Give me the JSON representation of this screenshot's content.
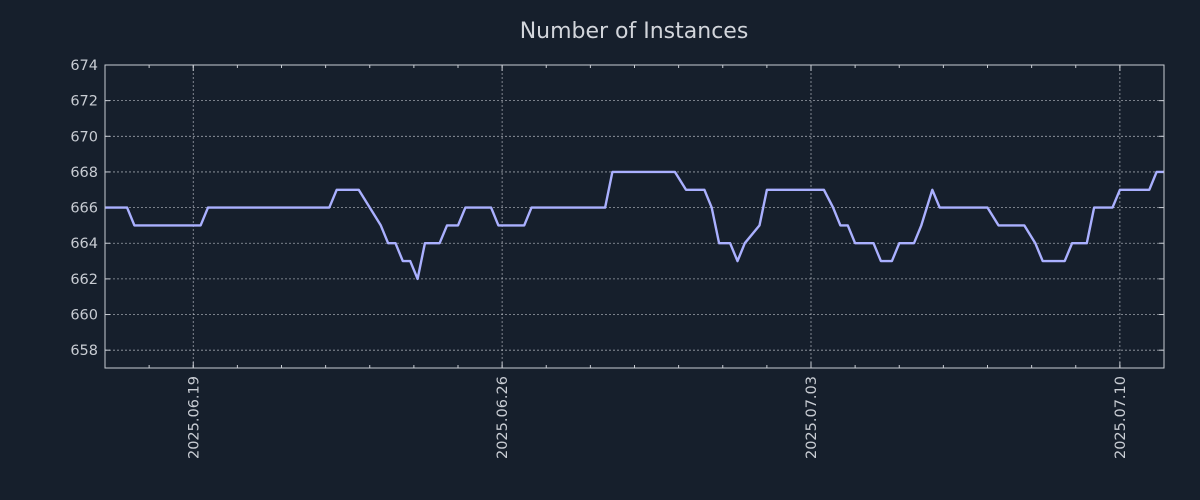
{
  "chart_data": {
    "type": "line",
    "title": "Number of Instances",
    "xlabel": "",
    "ylabel": "",
    "x_range": [
      "2025.06.17",
      "2025.07.11"
    ],
    "ylim": [
      657,
      674
    ],
    "y_ticks": [
      658,
      660,
      662,
      664,
      666,
      668,
      670,
      672,
      674
    ],
    "x_ticks": [
      "2025.06.19",
      "2025.06.26",
      "2025.07.03",
      "2025.07.10"
    ],
    "grid": true,
    "series": [
      {
        "name": "",
        "color": "#aab0ff",
        "points": [
          [
            "2025.06.17 00:00",
            666
          ],
          [
            "2025.06.17 12:00",
            666
          ],
          [
            "2025.06.17 16:00",
            665
          ],
          [
            "2025.06.18 00:00",
            665
          ],
          [
            "2025.06.18 12:00",
            665
          ],
          [
            "2025.06.18 18:00",
            665
          ],
          [
            "2025.06.19 04:00",
            665
          ],
          [
            "2025.06.19 08:00",
            666
          ],
          [
            "2025.06.20 00:00",
            666
          ],
          [
            "2025.06.21 00:00",
            666
          ],
          [
            "2025.06.22 00:00",
            666
          ],
          [
            "2025.06.22 02:00",
            666
          ],
          [
            "2025.06.22 06:00",
            667
          ],
          [
            "2025.06.22 18:00",
            667
          ],
          [
            "2025.06.23 00:00",
            666
          ],
          [
            "2025.06.23 06:00",
            665
          ],
          [
            "2025.06.23 10:00",
            664
          ],
          [
            "2025.06.23 14:00",
            664
          ],
          [
            "2025.06.23 18:00",
            663
          ],
          [
            "2025.06.23 22:00",
            663
          ],
          [
            "2025.06.24 02:00",
            662
          ],
          [
            "2025.06.24 06:00",
            664
          ],
          [
            "2025.06.24 14:00",
            664
          ],
          [
            "2025.06.24 18:00",
            665
          ],
          [
            "2025.06.25 00:00",
            665
          ],
          [
            "2025.06.25 04:00",
            666
          ],
          [
            "2025.06.25 18:00",
            666
          ],
          [
            "2025.06.25 22:00",
            665
          ],
          [
            "2025.06.26 12:00",
            665
          ],
          [
            "2025.06.26 16:00",
            666
          ],
          [
            "2025.06.27 00:00",
            666
          ],
          [
            "2025.06.28 00:00",
            666
          ],
          [
            "2025.06.28 08:00",
            666
          ],
          [
            "2025.06.28 12:00",
            668
          ],
          [
            "2025.06.29 00:00",
            668
          ],
          [
            "2025.06.29 22:00",
            668
          ],
          [
            "2025.06.30 04:00",
            667
          ],
          [
            "2025.06.30 14:00",
            667
          ],
          [
            "2025.06.30 18:00",
            666
          ],
          [
            "2025.06.30 22:00",
            664
          ],
          [
            "2025.07.01 04:00",
            664
          ],
          [
            "2025.07.01 08:00",
            663
          ],
          [
            "2025.07.01 12:00",
            664
          ],
          [
            "2025.07.01 20:00",
            665
          ],
          [
            "2025.07.02 00:00",
            667
          ],
          [
            "2025.07.02 12:00",
            667
          ],
          [
            "2025.07.03 00:00",
            667
          ],
          [
            "2025.07.03 07:00",
            667
          ],
          [
            "2025.07.03 12:00",
            666
          ],
          [
            "2025.07.03 16:00",
            665
          ],
          [
            "2025.07.03 20:00",
            665
          ],
          [
            "2025.07.04 00:00",
            664
          ],
          [
            "2025.07.04 10:00",
            664
          ],
          [
            "2025.07.04 14:00",
            663
          ],
          [
            "2025.07.04 20:00",
            663
          ],
          [
            "2025.07.05 00:00",
            664
          ],
          [
            "2025.07.05 08:00",
            664
          ],
          [
            "2025.07.05 12:00",
            665
          ],
          [
            "2025.07.05 18:00",
            667
          ],
          [
            "2025.07.05 22:00",
            666
          ],
          [
            "2025.07.07 00:00",
            666
          ],
          [
            "2025.07.07 06:00",
            665
          ],
          [
            "2025.07.07 20:00",
            665
          ],
          [
            "2025.07.08 02:00",
            664
          ],
          [
            "2025.07.08 06:00",
            663
          ],
          [
            "2025.07.08 18:00",
            663
          ],
          [
            "2025.07.08 22:00",
            664
          ],
          [
            "2025.07.09 06:00",
            664
          ],
          [
            "2025.07.09 10:00",
            666
          ],
          [
            "2025.07.09 20:00",
            666
          ],
          [
            "2025.07.10 00:00",
            667
          ],
          [
            "2025.07.10 16:00",
            667
          ],
          [
            "2025.07.10 20:00",
            668
          ],
          [
            "2025.07.11 14:00",
            668
          ],
          [
            "2025.07.11 18:00",
            669
          ],
          [
            "2025.07.12 10:00",
            669
          ]
        ]
      }
    ]
  }
}
